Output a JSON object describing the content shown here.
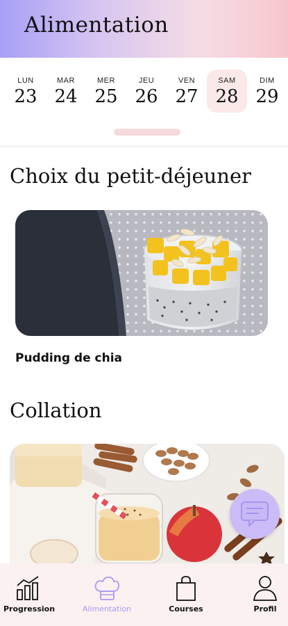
{
  "header": {
    "title": "Alimentation"
  },
  "calendar": {
    "days": [
      {
        "dow": "LUN",
        "num": "23"
      },
      {
        "dow": "MAR",
        "num": "24"
      },
      {
        "dow": "MER",
        "num": "25"
      },
      {
        "dow": "JEU",
        "num": "26"
      },
      {
        "dow": "VEN",
        "num": "27"
      },
      {
        "dow": "SAM",
        "num": "28"
      },
      {
        "dow": "DIM",
        "num": "29"
      }
    ],
    "selected_index": 5
  },
  "sections": {
    "breakfast": {
      "title": "Choix du petit-déjeuner",
      "item_name": "Pudding de chia"
    },
    "snack": {
      "title": "Collation"
    }
  },
  "bottom_nav": {
    "items": [
      {
        "label": "Progression",
        "icon": "chart-icon"
      },
      {
        "label": "Alimentation",
        "icon": "chef-hat-icon",
        "active": true
      },
      {
        "label": "Courses",
        "icon": "shopping-bag-icon"
      },
      {
        "label": "Profil",
        "icon": "user-icon"
      }
    ]
  },
  "colors": {
    "accent": "#a99bf2",
    "selected_day_bg": "#fbe9ea",
    "nav_bg": "#fbf1f1"
  }
}
